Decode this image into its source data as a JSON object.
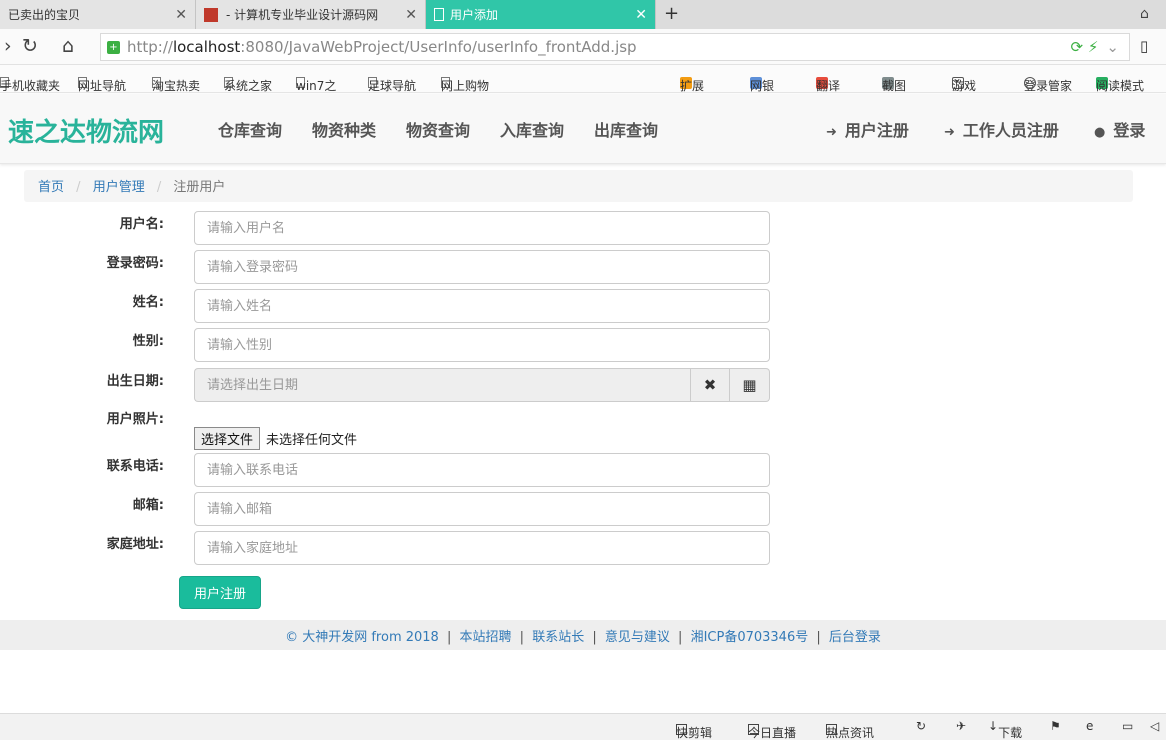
{
  "browser": {
    "tabs": [
      {
        "label": "已卖出的宝贝"
      },
      {
        "label": "- 计算机专业毕业设计源码网"
      },
      {
        "label": "用户添加"
      }
    ],
    "url_protocol": "http://",
    "url_host": "localhost",
    "url_path": ":8080/JavaWebProject/UserInfo/userInfo_frontAdd.jsp",
    "bookmarks": [
      "手机收藏夹",
      "网址导航",
      "淘宝热卖",
      "系统之家",
      "win7之",
      "足球导航",
      "网上购物"
    ],
    "bookmarks_right": [
      "扩展",
      "网银",
      "翻译",
      "截图",
      "游戏",
      "登录管家",
      "阅读模式"
    ]
  },
  "site": {
    "brand": "速之达物流网",
    "nav": [
      "仓库查询",
      "物资种类",
      "物资查询",
      "入库查询",
      "出库查询"
    ],
    "nav_right": [
      "用户注册",
      "工作人员注册",
      "登录"
    ]
  },
  "breadcrumb": {
    "home": "首页",
    "section": "用户管理",
    "current": "注册用户",
    "separator": "/"
  },
  "form": {
    "username": {
      "label": "用户名:",
      "placeholder": "请输入用户名"
    },
    "password": {
      "label": "登录密码:",
      "placeholder": "请输入登录密码"
    },
    "name": {
      "label": "姓名:",
      "placeholder": "请输入姓名"
    },
    "gender": {
      "label": "性别:",
      "placeholder": "请输入性别"
    },
    "birthday": {
      "label": "出生日期:",
      "placeholder": "请选择出生日期"
    },
    "photo": {
      "label": "用户照片:",
      "button": "选择文件",
      "status": "未选择任何文件"
    },
    "phone": {
      "label": "联系电话:",
      "placeholder": "请输入联系电话"
    },
    "email": {
      "label": "邮箱:",
      "placeholder": "请输入邮箱"
    },
    "address": {
      "label": "家庭地址:",
      "placeholder": "请输入家庭地址"
    },
    "submit": "用户注册"
  },
  "footer": {
    "copyright": "© 大神开发网 from 2018",
    "links": [
      "本站招聘",
      "联系站长",
      "意见与建议",
      "湘ICP备0703346号",
      "后台登录"
    ]
  },
  "statusbar": [
    "快剪辑",
    "今日直播",
    "热点资讯",
    "下载"
  ],
  "icons": {
    "brand_color": "#29b39a",
    "submit_color": "#1abc9c",
    "tab_active_color": "#30c6a8"
  }
}
